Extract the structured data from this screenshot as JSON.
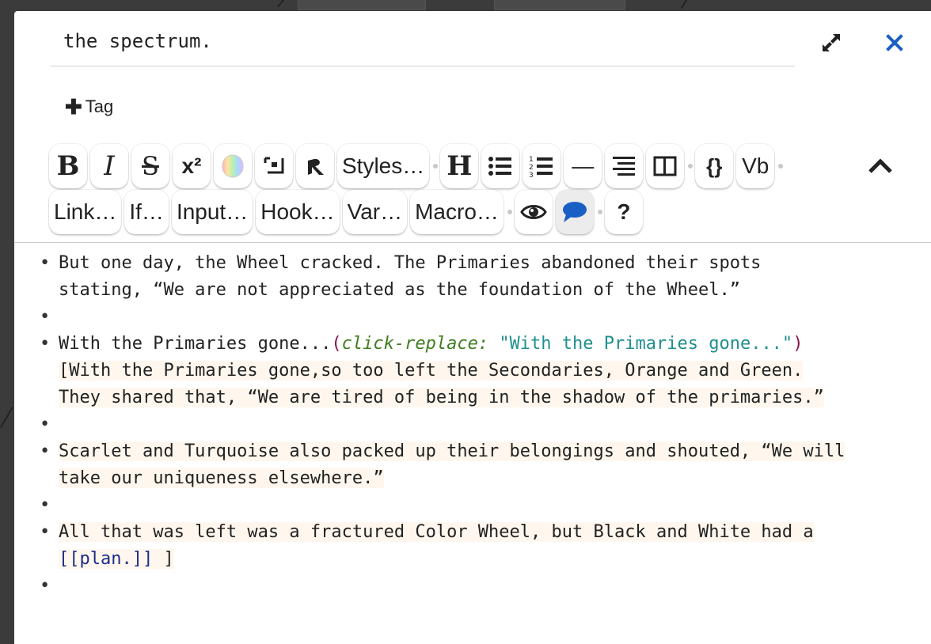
{
  "dialog": {
    "passage_name": "the spectrum.",
    "maximize_icon": "expand-arrows-icon",
    "close_icon": "close-x-icon",
    "tag_button_label": "Tag"
  },
  "toolbar": {
    "row1": [
      {
        "name": "bold-button",
        "label": "B"
      },
      {
        "name": "italic-button",
        "label": "I"
      },
      {
        "name": "strikethrough-button",
        "label": "S"
      },
      {
        "name": "superscript-button",
        "label": "x²"
      },
      {
        "name": "colour-button",
        "label": ""
      },
      {
        "name": "collapse-whitespace-button",
        "label": ""
      },
      {
        "name": "verbatim-r-button",
        "label": ""
      },
      {
        "name": "styles-button",
        "label": "Styles…"
      },
      {
        "name": "heading-button",
        "label": "H"
      },
      {
        "name": "bulleted-list-button",
        "label": ""
      },
      {
        "name": "numbered-list-button",
        "label": ""
      },
      {
        "name": "horizontal-rule-button",
        "label": "—"
      },
      {
        "name": "align-button",
        "label": ""
      },
      {
        "name": "columns-button",
        "label": ""
      },
      {
        "name": "code-button",
        "label": "{}"
      },
      {
        "name": "verbatim-button",
        "label": "Vb"
      }
    ],
    "row2": [
      {
        "name": "link-button",
        "label": "Link…"
      },
      {
        "name": "if-button",
        "label": "If…"
      },
      {
        "name": "input-button",
        "label": "Input…"
      },
      {
        "name": "hook-button",
        "label": "Hook…"
      },
      {
        "name": "var-button",
        "label": "Var…"
      },
      {
        "name": "macro-button",
        "label": "Macro…"
      },
      {
        "name": "preview-button",
        "label": ""
      },
      {
        "name": "comment-button",
        "label": ""
      },
      {
        "name": "help-button",
        "label": "?"
      }
    ]
  },
  "content": {
    "line1a": "But one day, the Wheel cracked. The Primaries abandoned their spots",
    "line1b": "stating, “We are not appreciated as the foundation of the Wheel.”",
    "line3_pre": "With the Primaries gone...",
    "line3_open": "(",
    "line3_macro": "click-replace:",
    "line3_str": "\"With the Primaries gone...\"",
    "line3_close": ")",
    "line3b": "[With the Primaries gone,so too left the Secondaries, Orange and Green.",
    "line3c": "They shared that, “We are tired of being in the shadow of the primaries.”",
    "line5a": "Scarlet and Turquoise also packed up their belongings and shouted, “We will",
    "line5b": "take our uniqueness elsewhere.”",
    "line7a": "All that was left was a fractured Color Wheel, but Black and White had a",
    "line7_link": "[[plan.]]",
    "line7_end": " ]",
    "bullet": "•"
  }
}
